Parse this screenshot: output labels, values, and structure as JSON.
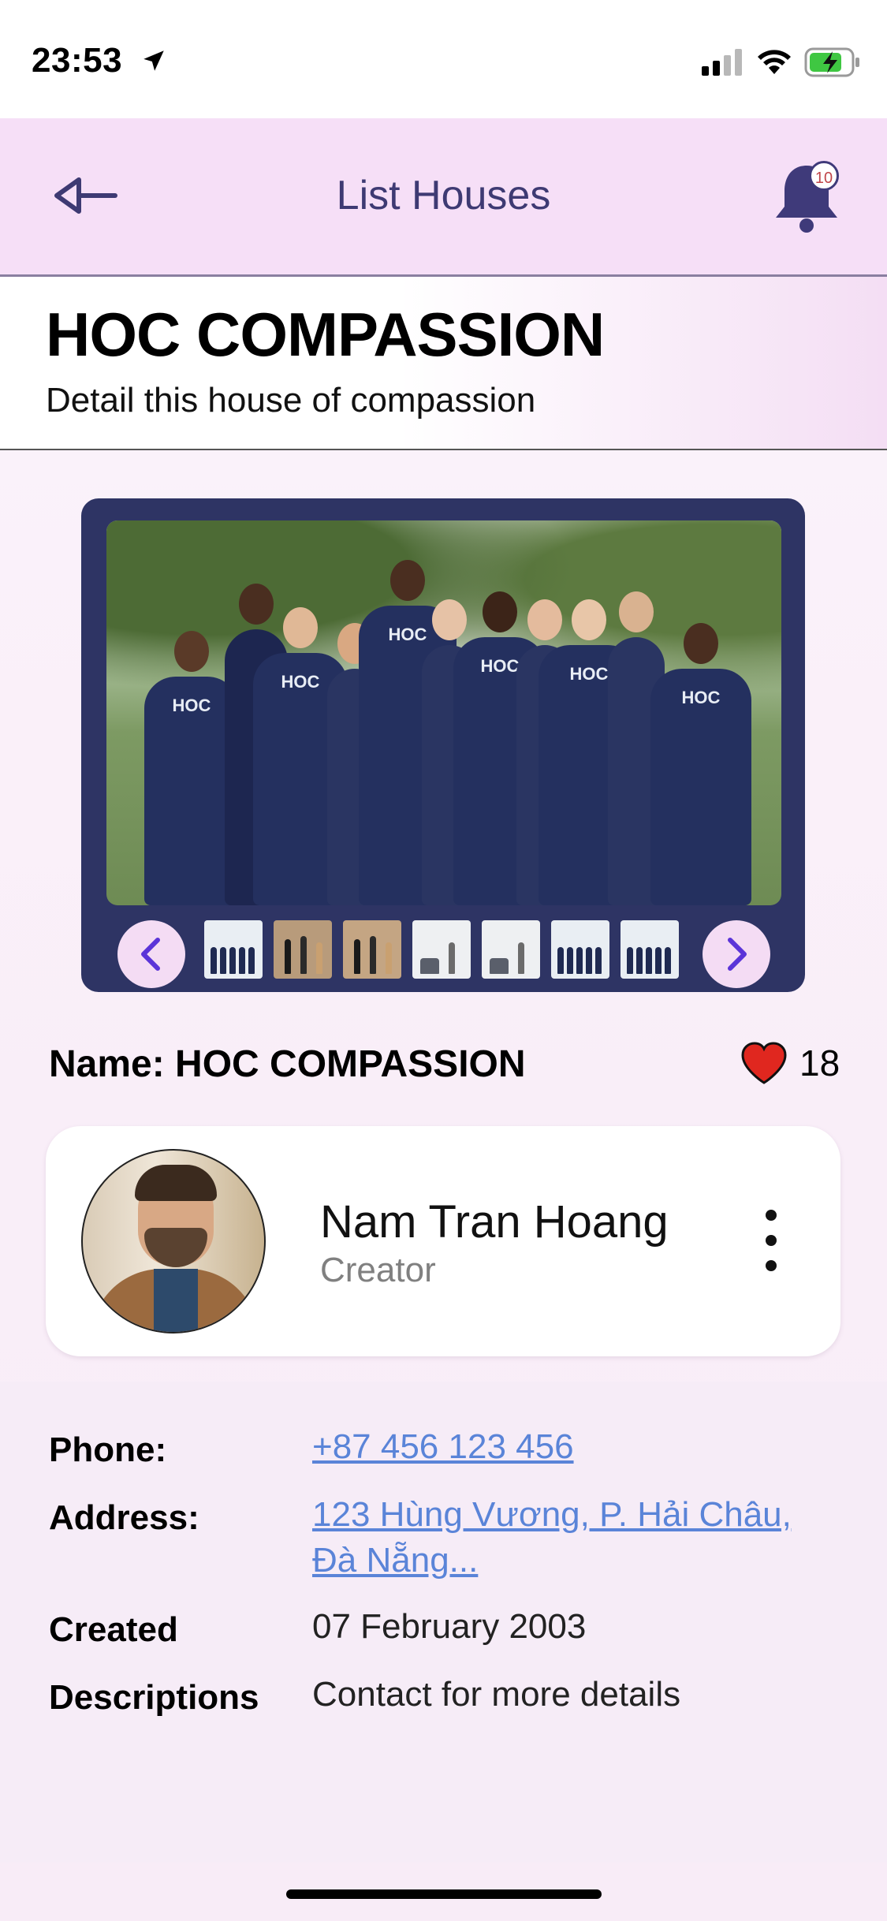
{
  "status_bar": {
    "time": "23:53",
    "icons": [
      "location-arrow-icon",
      "cellular-signal-icon",
      "wifi-icon",
      "battery-charging-icon"
    ]
  },
  "app_bar": {
    "title": "List Houses",
    "back_icon": "back-arrow-icon",
    "notification_icon": "bell-icon",
    "notification_count": "10"
  },
  "page": {
    "title": "HOC COMPASSION",
    "subtitle": "Detail this house of compassion"
  },
  "gallery": {
    "photo_logo_text": "HOC",
    "prev_icon": "chevron-left-icon",
    "next_icon": "chevron-right-icon",
    "thumbnail_count": 7
  },
  "house": {
    "name_line": "Name: HOC COMPASSION",
    "likes": "18",
    "like_icon": "heart-icon"
  },
  "creator": {
    "name": "Nam Tran Hoang",
    "role": "Creator",
    "menu_icon": "more-vertical-icon"
  },
  "details": {
    "phone_label": "Phone:",
    "phone_value": "+87 456 123 456",
    "address_label": "Address:",
    "address_value": "123 Hùng Vương, P. Hải Châu, Đà Nẵng...",
    "created_label": "Created",
    "created_value": "07 February 2003",
    "descriptions_label": "Descriptions",
    "descriptions_value": "Contact for more details"
  },
  "colors": {
    "accent": "#3e3a73",
    "appbar_bg": "#f6dff7",
    "gallery_frame": "#2e3464",
    "link": "#5a84d8",
    "heart": "#e0271f"
  }
}
